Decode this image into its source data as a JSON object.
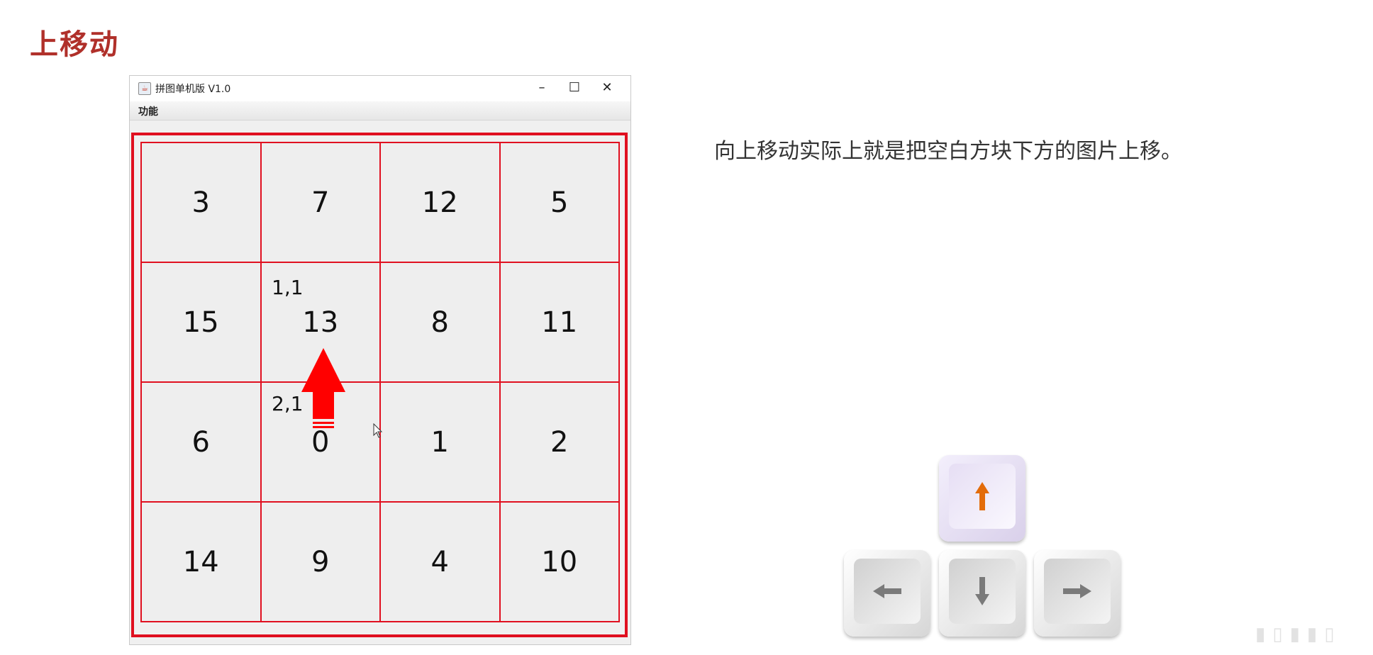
{
  "slide": {
    "title": "上移动",
    "caption": "向上移动实际上就是把空白方块下方的图片上移。"
  },
  "window": {
    "title": "拼图单机版 V1.0",
    "minimize": "–",
    "maximize": "☐",
    "close": "✕",
    "menu": "功能"
  },
  "board": {
    "rows": [
      [
        "3",
        "7",
        "12",
        "5"
      ],
      [
        "15",
        "13",
        "8",
        "11"
      ],
      [
        "6",
        "0",
        "1",
        "2"
      ],
      [
        "14",
        "9",
        "4",
        "10"
      ]
    ],
    "annotations": {
      "upper": "1,1",
      "lower": "2,1"
    },
    "arrow_color": "#ff0000",
    "grid_color": "#e01020"
  },
  "keys": {
    "up": {
      "icon": "arrow-up-icon",
      "color": "#e36c0a",
      "pressed": true
    },
    "left": {
      "icon": "arrow-left-icon",
      "color": "#7a7a7a"
    },
    "down": {
      "icon": "arrow-down-icon",
      "color": "#7a7a7a"
    },
    "right": {
      "icon": "arrow-right-icon",
      "color": "#7a7a7a"
    }
  }
}
